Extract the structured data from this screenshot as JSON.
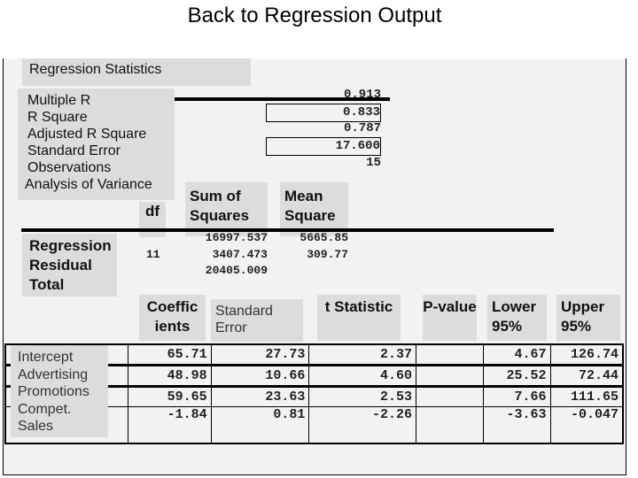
{
  "title": "Back to Regression Output",
  "stats": {
    "header": "Regression Statistics",
    "labels": [
      "Multiple R",
      "R Square",
      "Adjusted R Square",
      "Standard Error",
      "Observations",
      "Analysis of Variance"
    ],
    "values": [
      "0.913",
      "0.833",
      "0.787",
      "17.600",
      "15"
    ]
  },
  "anova": {
    "headers": {
      "df": "df",
      "ss": "Sum of Squares",
      "ms": "Mean Square"
    },
    "rows": [
      "Regression",
      "Residual",
      "Total"
    ],
    "df": "11",
    "ss": [
      "16997.537",
      "3407.473",
      "20405.009"
    ],
    "ms": [
      "5665.85",
      "309.77"
    ]
  },
  "coef": {
    "headers": [
      "Coeffic ients",
      "Standard Error",
      "t Statistic",
      "P-value",
      "Lower 95%",
      "Upper 95%"
    ],
    "rows": [
      {
        "label": "Intercept",
        "values": [
          "65.71",
          "27.73",
          "2.37",
          "",
          "4.67",
          "126.74"
        ]
      },
      {
        "label": "Advertising",
        "values": [
          "48.98",
          "10.66",
          "4.60",
          "",
          "25.52",
          "72.44"
        ]
      },
      {
        "label": "Promotions",
        "values": [
          "59.65",
          "23.63",
          "2.53",
          "",
          "7.66",
          "111.65"
        ]
      },
      {
        "label": "Compet. Sales",
        "values": [
          "-1.84",
          "0.81",
          "-2.26",
          "",
          "-3.63",
          "-0.047"
        ]
      }
    ]
  }
}
